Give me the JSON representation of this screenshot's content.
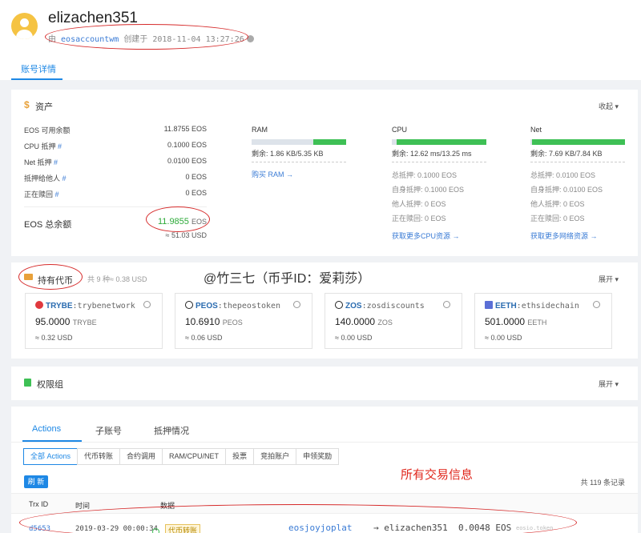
{
  "header": {
    "account_name": "elizachen351",
    "creator": "eosaccountwm",
    "created_label": "创建于",
    "created_time": "2018-11-04 13:27:26",
    "tab": "账号详情"
  },
  "assets": {
    "title": "资产",
    "collapse": "收起",
    "rows": [
      {
        "label": "EOS 可用余额",
        "link": "",
        "value": "11.8755 EOS"
      },
      {
        "label": "CPU 抵押",
        "link": "#",
        "value": "0.1000 EOS"
      },
      {
        "label": "Net 抵押",
        "link": "#",
        "value": "0.0100 EOS"
      },
      {
        "label": "抵押给他人",
        "link": "#",
        "value": "0 EOS"
      },
      {
        "label": "正在赎回",
        "link": "#",
        "value": "0 EOS"
      }
    ],
    "total_label": "EOS 总余额",
    "total_value": "11.9855",
    "total_unit": "EOS",
    "total_usd": "≈ 51.03 USD",
    "ram": {
      "title": "RAM",
      "used_fraction": 0.35,
      "remain": "剩余: 1.86 KB/5.35 KB",
      "link": "购买 RAM →"
    },
    "cpu": {
      "title": "CPU",
      "used_fraction": 0.95,
      "remain": "剩余: 12.62 ms/13.25 ms",
      "stats": [
        "总抵押: 0.1000 EOS",
        "自身抵押: 0.1000 EOS",
        "他人抵押: 0 EOS",
        "正在赎回: 0 EOS"
      ],
      "link": "获取更多CPU资源 →"
    },
    "net": {
      "title": "Net",
      "used_fraction": 0.98,
      "remain": "剩余: 7.69 KB/7.84 KB",
      "stats": [
        "总抵押: 0.0100 EOS",
        "自身抵押: 0.0100 EOS",
        "他人抵押: 0 EOS",
        "正在赎回: 0 EOS"
      ],
      "link": "获取更多网络资源 →"
    }
  },
  "tokens": {
    "title": "持有代币",
    "summary": "共 9 种≈ 0.38 USD",
    "expand": "展开",
    "watermark": "@竹三七（币乎ID：爱莉莎）",
    "items": [
      {
        "symbol": "TRYBE",
        "account": ":trybenetwork",
        "amount": "95.0000",
        "unit": "TRYBE",
        "usd": "≈ 0.32 USD",
        "icon_color": "#e0393e"
      },
      {
        "symbol": "PEOS",
        "account": ":thepeostoken",
        "amount": "10.6910",
        "unit": "PEOS",
        "usd": "≈ 0.06 USD",
        "icon_color": "#222222"
      },
      {
        "symbol": "ZOS",
        "account": ":zosdiscounts",
        "amount": "140.0000",
        "unit": "ZOS",
        "usd": "≈ 0.00 USD",
        "icon_color": "#222222"
      },
      {
        "symbol": "EETH",
        "account": ":ethsidechain",
        "amount": "501.0000",
        "unit": "EETH",
        "usd": "≈ 0.00 USD",
        "icon_color": "#5b6fd6"
      }
    ]
  },
  "permissions": {
    "title": "权限组",
    "expand": "展开"
  },
  "actions": {
    "tabs": [
      "Actions",
      "子账号",
      "抵押情况"
    ],
    "filters": [
      "全部 Actions",
      "代币转账",
      "合约调用",
      "RAM/CPU/NET",
      "投票",
      "竞拍账户",
      "申领奖励"
    ],
    "refresh": "刷 新",
    "annotation": "所有交易信息",
    "count": "共 119 条记录",
    "headers": [
      "Trx ID",
      "时间",
      "数据"
    ],
    "row": {
      "trx": "d5653",
      "time": "2019-03-29 00:00:34",
      "badge": "代币转账",
      "from": "eosjoyjoplat",
      "to": "→ elizachen351",
      "amount": "0.0048 EOS",
      "contract": "eosio.token"
    }
  }
}
